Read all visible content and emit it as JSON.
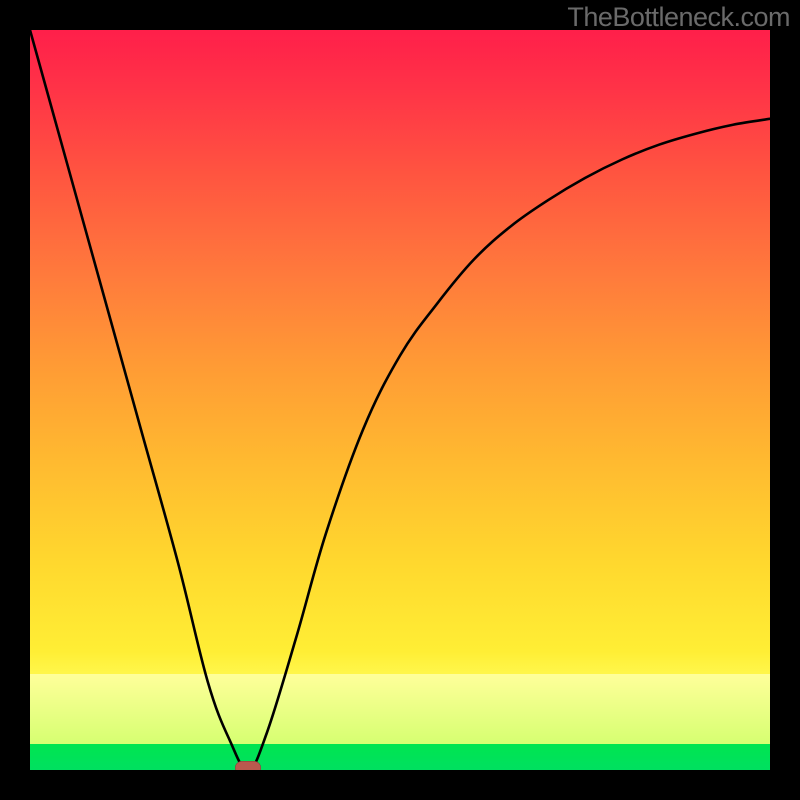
{
  "watermark": "TheBottleneck.com",
  "chart_data": {
    "type": "line",
    "title": "",
    "xlabel": "",
    "ylabel": "",
    "xlim": [
      0,
      100
    ],
    "ylim": [
      0,
      100
    ],
    "grid": false,
    "legend": false,
    "series": [
      {
        "name": "bottleneck-curve",
        "x": [
          0,
          5,
          10,
          15,
          20,
          24,
          27,
          29.5,
          32,
          36,
          40,
          45,
          50,
          55,
          60,
          65,
          70,
          75,
          80,
          85,
          90,
          95,
          100
        ],
        "values": [
          100,
          82,
          64,
          46,
          28,
          12,
          4,
          0,
          5,
          18,
          32,
          46,
          56,
          63,
          69,
          73.5,
          77,
          80,
          82.5,
          84.5,
          86,
          87.2,
          88
        ]
      }
    ],
    "minimum_point": {
      "x": 29.5,
      "y": 0
    },
    "background_gradient": {
      "top": "#ff1f4a",
      "mid": "#ffd82e",
      "band": "#ffff9a",
      "bottom": "#00e550"
    },
    "marker_color": "#b9594e"
  }
}
